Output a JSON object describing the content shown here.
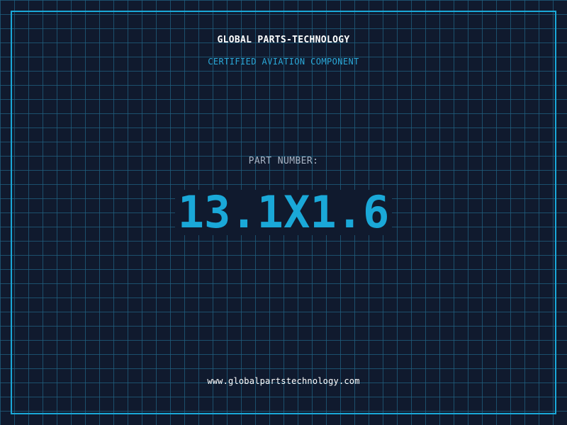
{
  "header": {
    "company": "GLOBAL PARTS-TECHNOLOGY",
    "subtitle": "CERTIFIED AVIATION COMPONENT"
  },
  "main": {
    "label": "PART NUMBER:",
    "part_number": "13.1X1.6"
  },
  "footer": {
    "website": "www.globalpartstechnology.com"
  },
  "colors": {
    "background": "#101a2e",
    "grid": "#206080",
    "accent": "#1aa8d8",
    "label": "#a8b4c4",
    "text": "#ffffff"
  }
}
